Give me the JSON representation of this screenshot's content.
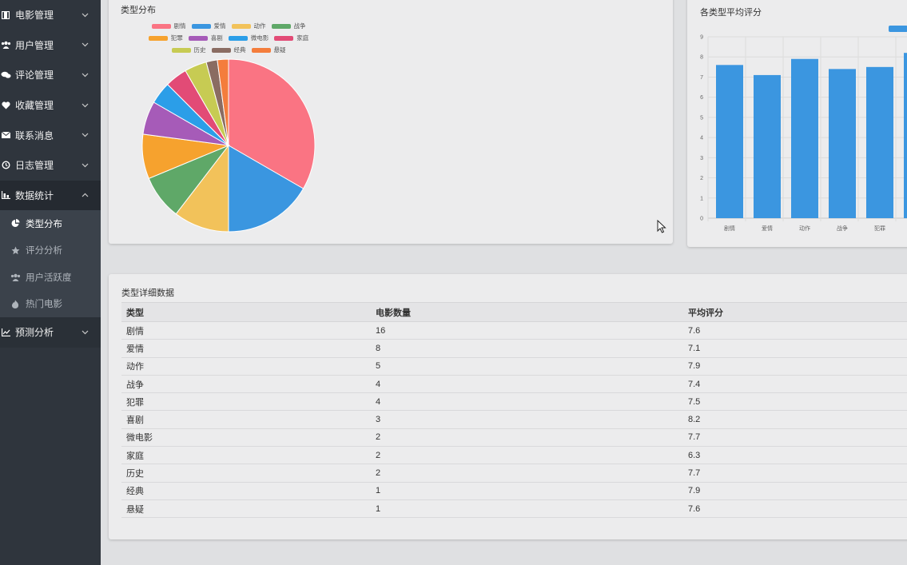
{
  "sidebar": {
    "items": [
      {
        "label": "电影管理",
        "icon": "film-icon"
      },
      {
        "label": "用户管理",
        "icon": "users-icon"
      },
      {
        "label": "评论管理",
        "icon": "comments-icon"
      },
      {
        "label": "收藏管理",
        "icon": "heart-icon"
      },
      {
        "label": "联系消息",
        "icon": "envelope-icon"
      },
      {
        "label": "日志管理",
        "icon": "history-icon"
      },
      {
        "label": "数据统计",
        "icon": "bar-chart-icon"
      },
      {
        "label": "预测分析",
        "icon": "line-chart-icon"
      }
    ],
    "stats_sub": [
      {
        "label": "类型分布",
        "icon": "pie-chart-icon"
      },
      {
        "label": "评分分析",
        "icon": "star-icon"
      },
      {
        "label": "用户活跃度",
        "icon": "users-icon"
      },
      {
        "label": "热门电影",
        "icon": "fire-icon"
      }
    ]
  },
  "pie_card": {
    "title": "类型分布"
  },
  "bar_card": {
    "title": "各类型平均评分"
  },
  "table_card": {
    "title": "类型详细数据",
    "headers": [
      "类型",
      "电影数量",
      "平均评分"
    ],
    "rows": [
      [
        "剧情",
        "16",
        "7.6"
      ],
      [
        "爱情",
        "8",
        "7.1"
      ],
      [
        "动作",
        "5",
        "7.9"
      ],
      [
        "战争",
        "4",
        "7.4"
      ],
      [
        "犯罪",
        "4",
        "7.5"
      ],
      [
        "喜剧",
        "3",
        "8.2"
      ],
      [
        "微电影",
        "2",
        "7.7"
      ],
      [
        "家庭",
        "2",
        "6.3"
      ],
      [
        "历史",
        "2",
        "7.7"
      ],
      [
        "经典",
        "1",
        "7.9"
      ],
      [
        "悬疑",
        "1",
        "7.6"
      ]
    ]
  },
  "colors": {
    "accent_bar": "#3b96e0",
    "sidebar_bg": "#2f353d"
  },
  "chart_data": [
    {
      "type": "pie",
      "title": "类型分布",
      "categories": [
        "剧情",
        "爱情",
        "动作",
        "战争",
        "犯罪",
        "喜剧",
        "微电影",
        "家庭",
        "历史",
        "经典",
        "悬疑"
      ],
      "values": [
        16,
        8,
        5,
        4,
        4,
        3,
        2,
        2,
        2,
        1,
        1
      ],
      "colors": [
        "#fa7483",
        "#3a96e0",
        "#f2c25a",
        "#5fa868",
        "#f6a22e",
        "#a65bb8",
        "#2b9ee8",
        "#e24b76",
        "#c7cb53",
        "#8a6c62",
        "#f47d3c"
      ],
      "legend": "top"
    },
    {
      "type": "bar",
      "title": "各类型平均评分",
      "categories": [
        "剧情",
        "爱情",
        "动作",
        "战争",
        "犯罪"
      ],
      "values": [
        7.6,
        7.1,
        7.9,
        7.4,
        7.5
      ],
      "ylim": [
        0,
        9
      ],
      "yticks": [
        0,
        1,
        2,
        3,
        4,
        5,
        6,
        7,
        8,
        9
      ],
      "grid": true,
      "color": "#3b96e0"
    }
  ]
}
